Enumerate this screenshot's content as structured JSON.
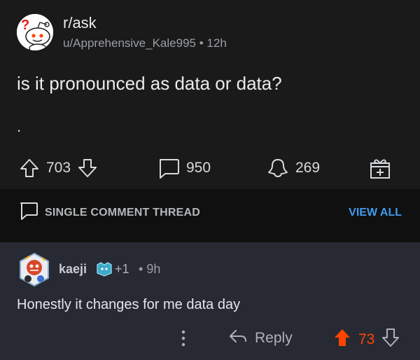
{
  "post": {
    "subreddit": "r/ask",
    "username": "u/Apprehensive_Kale995",
    "separator": "•",
    "age": "12h",
    "title": "is it pronounced as data or data?",
    "body": ".",
    "upvotes": "703",
    "comments": "950",
    "awards": "269"
  },
  "thread_bar": {
    "label": "SINGLE COMMENT THREAD",
    "view_all": "VIEW ALL"
  },
  "comment": {
    "username": "kaeji",
    "award_count": "+1",
    "separator": "•",
    "age": "9h",
    "body": "Honestly it changes for me data day",
    "reply_label": "Reply",
    "score": "73"
  },
  "colors": {
    "background": "#1a1a1b",
    "thread_bar": "#101010",
    "comment_bg": "#272a32",
    "accent_link": "#3f9bef",
    "upvote_active": "#ff4500"
  },
  "icons": [
    "snoo-avatar",
    "upvote-icon",
    "downvote-icon",
    "comment-icon",
    "share-icon",
    "gift-icon",
    "thread-comment-icon",
    "user-avatar",
    "award-icon",
    "more-icon",
    "reply-icon"
  ]
}
